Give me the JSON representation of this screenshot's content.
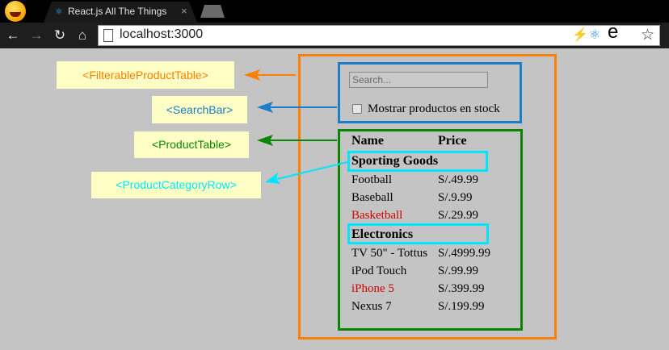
{
  "browser": {
    "tab": {
      "title": "React.js All The Things",
      "close": "×"
    },
    "toolbar": {
      "back": "←",
      "forward": "→",
      "reload": "↻",
      "home": "⌂",
      "url": "localhost:3000",
      "bolt": "⚡",
      "react": "⚛",
      "e": "e",
      "star": "☆"
    }
  },
  "labels": {
    "filterable": "<FilterableProductTable>",
    "searchbar": "<SearchBar>",
    "producttable": "<ProductTable>",
    "categoryrow": "<ProductCategoryRow>"
  },
  "colors": {
    "filterable": "#ff7f00",
    "searchbar": "#1a7ec8",
    "producttable": "#0a8500",
    "categoryrow": "#00e5ff",
    "out_of_stock": "#d10000"
  },
  "search": {
    "placeholder": "Search...",
    "value": "",
    "stock_label": "Mostrar productos en stock",
    "stock_checked": false
  },
  "table": {
    "headers": {
      "name": "Name",
      "price": "Price"
    },
    "categories": [
      {
        "name": "Sporting Goods",
        "products": [
          {
            "name": "Football",
            "price": "S/.49.99",
            "stocked": true
          },
          {
            "name": "Baseball",
            "price": "S/.9.99",
            "stocked": true
          },
          {
            "name": "Basketball",
            "price": "S/.29.99",
            "stocked": false
          }
        ]
      },
      {
        "name": "Electronics",
        "products": [
          {
            "name": "TV 50\" - Tottus",
            "price": "S/.4999.99",
            "stocked": true
          },
          {
            "name": "iPod Touch",
            "price": "S/.99.99",
            "stocked": true
          },
          {
            "name": "iPhone 5",
            "price": "S/.399.99",
            "stocked": false
          },
          {
            "name": "Nexus 7",
            "price": "S/.199.99",
            "stocked": true
          }
        ]
      }
    ]
  }
}
